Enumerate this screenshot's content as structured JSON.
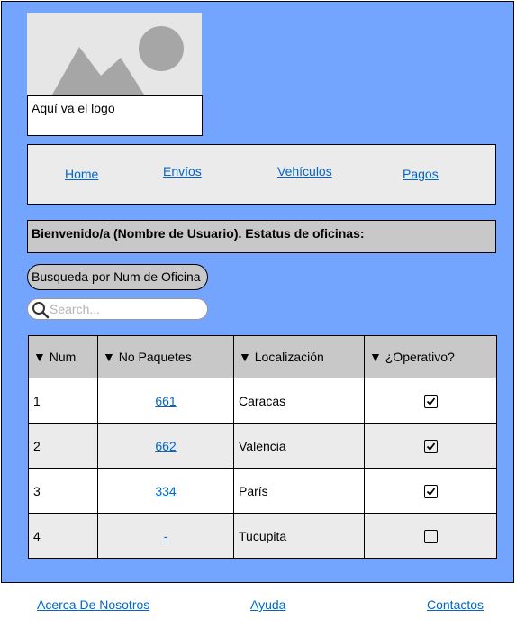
{
  "logo": {
    "caption": "Aquí va el logo",
    "image_icon": "image-placeholder-icon"
  },
  "nav": {
    "items": [
      {
        "label": "Home"
      },
      {
        "label": "Envíos"
      },
      {
        "label": "Vehículos"
      },
      {
        "label": "Pagos"
      }
    ]
  },
  "welcome": {
    "text": "Bienvenido/a (Nombre de Usuario). Estatus de oficinas:"
  },
  "search": {
    "button_label": "Busqueda por Num de Oficina",
    "placeholder": "Search...",
    "icon": "search-icon"
  },
  "table": {
    "headers": [
      "▼ Num",
      "▼ No Paquetes",
      "▼ Localización",
      "▼ ¿Operativo?"
    ],
    "rows": [
      {
        "num": "1",
        "paquetes": "661",
        "localizacion": "Caracas",
        "operativo": true
      },
      {
        "num": "2",
        "paquetes": "662",
        "localizacion": "Valencia",
        "operativo": true
      },
      {
        "num": "3",
        "paquetes": "334",
        "localizacion": "París",
        "operativo": true
      },
      {
        "num": "4",
        "paquetes": "-",
        "localizacion": "Tucupita",
        "operativo": false
      }
    ]
  },
  "footer": {
    "links": [
      {
        "label": "Acerca De Nosotros"
      },
      {
        "label": "Ayuda"
      },
      {
        "label": "Contactos"
      }
    ]
  },
  "colors": {
    "page_background": "#73a5ff",
    "link": "#0066cc",
    "header_gray": "#c8c8c8",
    "row_alt": "#ebebeb"
  }
}
